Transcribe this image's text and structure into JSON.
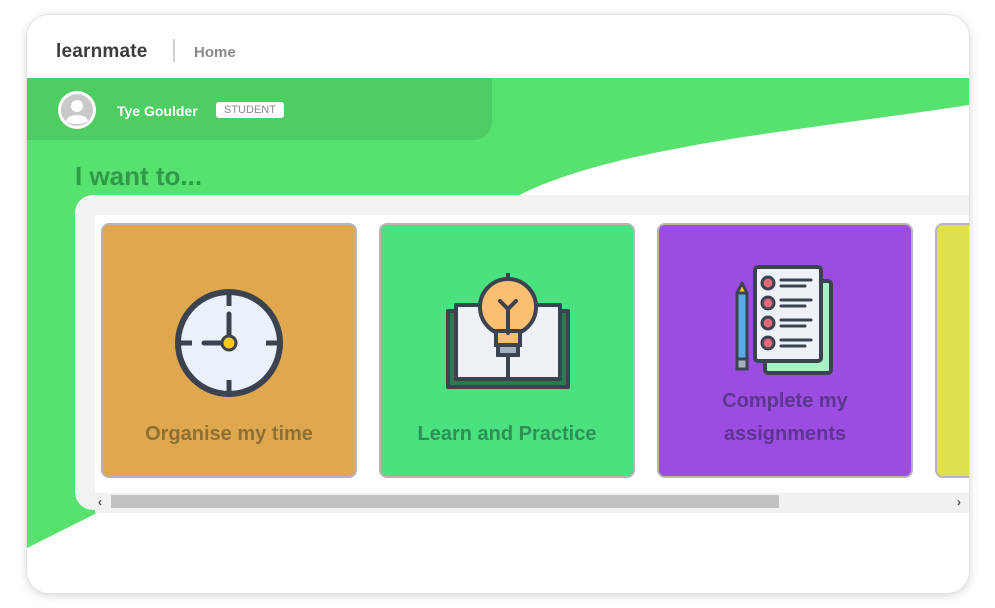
{
  "app": {
    "logo": "learnmate",
    "breadcrumb": "Home"
  },
  "user": {
    "name": "Tye Goulder",
    "role": "STUDENT"
  },
  "main": {
    "heading": "I want to...",
    "cards": [
      {
        "label": "Organise my time",
        "icon": "clock-icon",
        "color": "#e0a84e",
        "text_color": "#8d7036"
      },
      {
        "label": "Learn and Practice",
        "icon": "lightbulb-book-icon",
        "color": "#4ae17f",
        "text_color": "#2f8f57"
      },
      {
        "label_line1": "Complete my",
        "label_line2": "assignments",
        "icon": "checklist-icon",
        "color": "#9b4de2",
        "text_color": "#5e3590"
      },
      {
        "label": "",
        "icon": "",
        "color": "#dfe04f"
      }
    ]
  },
  "colors": {
    "accent_green": "#57e16f",
    "header_green": "#4ecd63",
    "heading_green": "#2f9a47"
  },
  "scrollbar": {
    "left_arrow": "‹",
    "right_arrow": "›"
  }
}
